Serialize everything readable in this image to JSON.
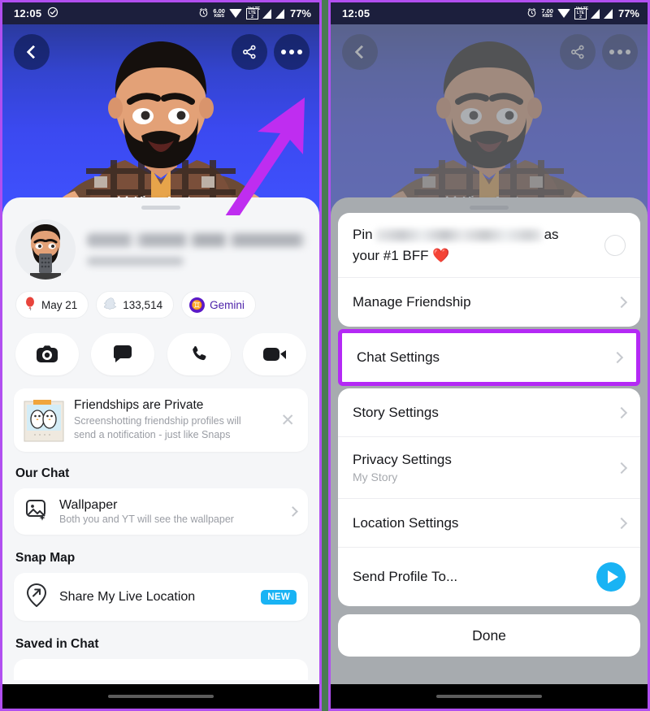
{
  "statusbar": {
    "time": "12:05",
    "check_icon": "check-circle-icon",
    "alarm_icon": "alarm-icon",
    "net_speed_value": "6.00",
    "net_speed_value_right": "7.00",
    "net_speed_unit": "KB/S",
    "wifi_icon": "wifi-icon",
    "volte_label_top": "VoLTE",
    "volte_label_bot": "LTE 2",
    "signal_icon": "signal-bars-icon",
    "battery": "77%"
  },
  "hero": {
    "back_icon": "chevron-left-icon",
    "share_icon": "share-icon",
    "more_icon": "more-horizontal-icon",
    "view_avatar_label": "View Avatar",
    "chevrons_icon": "double-chevron-down-icon",
    "annotation_arrow_color": "#bf2df0",
    "gradient_top": "#2b3a9e",
    "gradient_bottom": "#3f52ff"
  },
  "profile": {
    "avatar_name": "bitmoji-avatar",
    "display_name_redacted": "",
    "username_redacted": "",
    "chips": [
      {
        "icon": "balloon-icon",
        "label": "May 21"
      },
      {
        "icon": "snapchat-ghost-icon",
        "label": "133,514"
      },
      {
        "icon": "gemini-zodiac-icon",
        "label": "Gemini",
        "glyph": "♊"
      }
    ],
    "actions": [
      {
        "name": "camera-button",
        "icon": "camera-icon"
      },
      {
        "name": "chat-button",
        "icon": "chat-bubble-icon"
      },
      {
        "name": "call-button",
        "icon": "phone-icon"
      },
      {
        "name": "video-call-button",
        "icon": "video-camera-icon"
      }
    ],
    "banner": {
      "art_icon": "two-penguins-photo-icon",
      "title": "Friendships are Private",
      "subtitle_line1": "Screenshotting friendship profiles will",
      "subtitle_line2": "send a notification - just like Snaps",
      "close_icon": "close-icon"
    },
    "sections": [
      {
        "title": "Our Chat",
        "row": {
          "icon": "wallpaper-image-icon",
          "title": "Wallpaper",
          "subtitle": "Both you and YT will see the wallpaper",
          "chevron": "chevron-right-icon"
        }
      },
      {
        "title": "Snap Map",
        "row": {
          "icon": "location-pin-arrow-icon",
          "title": "Share My Live Location",
          "badge": "NEW",
          "badge_color": "#19b3f4"
        }
      }
    ],
    "saved_section_title": "Saved in Chat"
  },
  "action_sheet": {
    "pin_row": {
      "prefix": "Pin",
      "redacted_name": "",
      "suffix": "as",
      "line2": "your #1 BFF ❤️",
      "toggle_icon": "radio-circle-icon"
    },
    "items": [
      {
        "name": "manage-friendship",
        "label": "Manage Friendship",
        "chevron": "chevron-right-icon",
        "highlighted": false
      },
      {
        "name": "chat-settings",
        "label": "Chat Settings",
        "chevron": "chevron-right-icon",
        "highlighted": true
      },
      {
        "name": "story-settings",
        "label": "Story Settings",
        "chevron": "chevron-right-icon",
        "highlighted": false
      },
      {
        "name": "privacy-settings",
        "label": "Privacy Settings",
        "sub": "My Story",
        "chevron": "chevron-right-icon",
        "highlighted": false
      },
      {
        "name": "location-settings",
        "label": "Location Settings",
        "chevron": "chevron-right-icon",
        "highlighted": false
      },
      {
        "name": "send-profile-to",
        "label": "Send Profile To...",
        "send_icon": "send-arrow-icon",
        "highlighted": false
      }
    ],
    "done_label": "Done",
    "highlight_color": "#b429f5"
  },
  "navbar": {
    "pill_icon": "home-indicator-pill"
  }
}
